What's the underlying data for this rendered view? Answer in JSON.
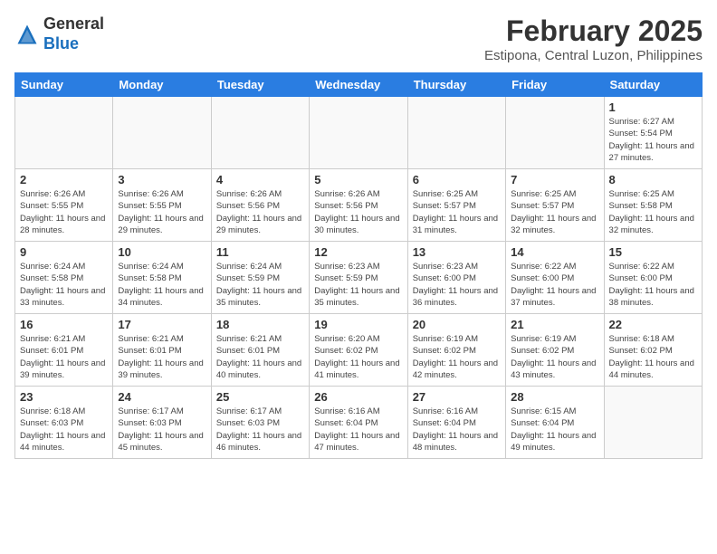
{
  "header": {
    "logo_general": "General",
    "logo_blue": "Blue",
    "month_year": "February 2025",
    "location": "Estipona, Central Luzon, Philippines"
  },
  "weekdays": [
    "Sunday",
    "Monday",
    "Tuesday",
    "Wednesday",
    "Thursday",
    "Friday",
    "Saturday"
  ],
  "weeks": [
    [
      {
        "day": "",
        "info": ""
      },
      {
        "day": "",
        "info": ""
      },
      {
        "day": "",
        "info": ""
      },
      {
        "day": "",
        "info": ""
      },
      {
        "day": "",
        "info": ""
      },
      {
        "day": "",
        "info": ""
      },
      {
        "day": "1",
        "info": "Sunrise: 6:27 AM\nSunset: 5:54 PM\nDaylight: 11 hours and 27 minutes."
      }
    ],
    [
      {
        "day": "2",
        "info": "Sunrise: 6:26 AM\nSunset: 5:55 PM\nDaylight: 11 hours and 28 minutes."
      },
      {
        "day": "3",
        "info": "Sunrise: 6:26 AM\nSunset: 5:55 PM\nDaylight: 11 hours and 29 minutes."
      },
      {
        "day": "4",
        "info": "Sunrise: 6:26 AM\nSunset: 5:56 PM\nDaylight: 11 hours and 29 minutes."
      },
      {
        "day": "5",
        "info": "Sunrise: 6:26 AM\nSunset: 5:56 PM\nDaylight: 11 hours and 30 minutes."
      },
      {
        "day": "6",
        "info": "Sunrise: 6:25 AM\nSunset: 5:57 PM\nDaylight: 11 hours and 31 minutes."
      },
      {
        "day": "7",
        "info": "Sunrise: 6:25 AM\nSunset: 5:57 PM\nDaylight: 11 hours and 32 minutes."
      },
      {
        "day": "8",
        "info": "Sunrise: 6:25 AM\nSunset: 5:58 PM\nDaylight: 11 hours and 32 minutes."
      }
    ],
    [
      {
        "day": "9",
        "info": "Sunrise: 6:24 AM\nSunset: 5:58 PM\nDaylight: 11 hours and 33 minutes."
      },
      {
        "day": "10",
        "info": "Sunrise: 6:24 AM\nSunset: 5:58 PM\nDaylight: 11 hours and 34 minutes."
      },
      {
        "day": "11",
        "info": "Sunrise: 6:24 AM\nSunset: 5:59 PM\nDaylight: 11 hours and 35 minutes."
      },
      {
        "day": "12",
        "info": "Sunrise: 6:23 AM\nSunset: 5:59 PM\nDaylight: 11 hours and 35 minutes."
      },
      {
        "day": "13",
        "info": "Sunrise: 6:23 AM\nSunset: 6:00 PM\nDaylight: 11 hours and 36 minutes."
      },
      {
        "day": "14",
        "info": "Sunrise: 6:22 AM\nSunset: 6:00 PM\nDaylight: 11 hours and 37 minutes."
      },
      {
        "day": "15",
        "info": "Sunrise: 6:22 AM\nSunset: 6:00 PM\nDaylight: 11 hours and 38 minutes."
      }
    ],
    [
      {
        "day": "16",
        "info": "Sunrise: 6:21 AM\nSunset: 6:01 PM\nDaylight: 11 hours and 39 minutes."
      },
      {
        "day": "17",
        "info": "Sunrise: 6:21 AM\nSunset: 6:01 PM\nDaylight: 11 hours and 39 minutes."
      },
      {
        "day": "18",
        "info": "Sunrise: 6:21 AM\nSunset: 6:01 PM\nDaylight: 11 hours and 40 minutes."
      },
      {
        "day": "19",
        "info": "Sunrise: 6:20 AM\nSunset: 6:02 PM\nDaylight: 11 hours and 41 minutes."
      },
      {
        "day": "20",
        "info": "Sunrise: 6:19 AM\nSunset: 6:02 PM\nDaylight: 11 hours and 42 minutes."
      },
      {
        "day": "21",
        "info": "Sunrise: 6:19 AM\nSunset: 6:02 PM\nDaylight: 11 hours and 43 minutes."
      },
      {
        "day": "22",
        "info": "Sunrise: 6:18 AM\nSunset: 6:02 PM\nDaylight: 11 hours and 44 minutes."
      }
    ],
    [
      {
        "day": "23",
        "info": "Sunrise: 6:18 AM\nSunset: 6:03 PM\nDaylight: 11 hours and 44 minutes."
      },
      {
        "day": "24",
        "info": "Sunrise: 6:17 AM\nSunset: 6:03 PM\nDaylight: 11 hours and 45 minutes."
      },
      {
        "day": "25",
        "info": "Sunrise: 6:17 AM\nSunset: 6:03 PM\nDaylight: 11 hours and 46 minutes."
      },
      {
        "day": "26",
        "info": "Sunrise: 6:16 AM\nSunset: 6:04 PM\nDaylight: 11 hours and 47 minutes."
      },
      {
        "day": "27",
        "info": "Sunrise: 6:16 AM\nSunset: 6:04 PM\nDaylight: 11 hours and 48 minutes."
      },
      {
        "day": "28",
        "info": "Sunrise: 6:15 AM\nSunset: 6:04 PM\nDaylight: 11 hours and 49 minutes."
      },
      {
        "day": "",
        "info": ""
      }
    ]
  ]
}
